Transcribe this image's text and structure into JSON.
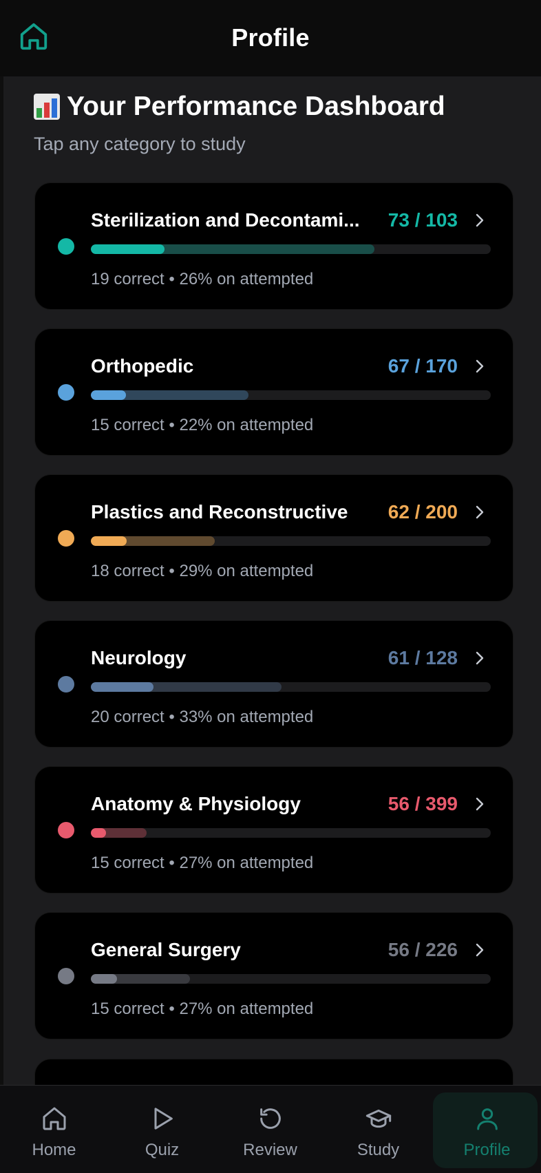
{
  "header": {
    "title": "Profile",
    "home_icon": "home-icon"
  },
  "dashboard": {
    "emoji_icon": "bar-chart-icon",
    "title": "Your Performance Dashboard",
    "subtitle": "Tap any category to study"
  },
  "categories": [
    {
      "name": "Sterilization and Decontami...",
      "score": "73 / 103",
      "meta_correct": "19 correct",
      "meta_sep": "•",
      "meta_pct": "26% on attempted",
      "color": "#14b8a6",
      "attempted_fraction": 0.709,
      "correct_fraction": 0.184
    },
    {
      "name": "Orthopedic",
      "score": "67 / 170",
      "meta_correct": "15 correct",
      "meta_sep": "•",
      "meta_pct": "22% on attempted",
      "color": "#5aa2dc",
      "attempted_fraction": 0.394,
      "correct_fraction": 0.088
    },
    {
      "name": "Plastics and Reconstructive",
      "score": "62 / 200",
      "meta_correct": "18 correct",
      "meta_sep": "•",
      "meta_pct": "29% on attempted",
      "color": "#f0aa55",
      "attempted_fraction": 0.31,
      "correct_fraction": 0.09
    },
    {
      "name": "Neurology",
      "score": "61 / 128",
      "meta_correct": "20 correct",
      "meta_sep": "•",
      "meta_pct": "33% on attempted",
      "color": "#5d7aa0",
      "attempted_fraction": 0.477,
      "correct_fraction": 0.156
    },
    {
      "name": "Anatomy & Physiology",
      "score": "56 / 399",
      "meta_correct": "15 correct",
      "meta_sep": "•",
      "meta_pct": "27% on attempted",
      "color": "#e85a6d",
      "attempted_fraction": 0.14,
      "correct_fraction": 0.038
    },
    {
      "name": "General Surgery",
      "score": "56 / 226",
      "meta_correct": "15 correct",
      "meta_sep": "•",
      "meta_pct": "27% on attempted",
      "color": "#767a85",
      "attempted_fraction": 0.248,
      "correct_fraction": 0.066
    }
  ],
  "tabs": [
    {
      "label": "Home",
      "icon": "home-icon",
      "active": false
    },
    {
      "label": "Quiz",
      "icon": "play-icon",
      "active": false
    },
    {
      "label": "Review",
      "icon": "refresh-icon",
      "active": false
    },
    {
      "label": "Study",
      "icon": "graduation-cap-icon",
      "active": false
    },
    {
      "label": "Profile",
      "icon": "person-icon",
      "active": true
    }
  ],
  "colors": {
    "accent": "#14806f",
    "background": "#1c1c1e",
    "card": "#000000",
    "muted_text": "#a2a8b3"
  }
}
